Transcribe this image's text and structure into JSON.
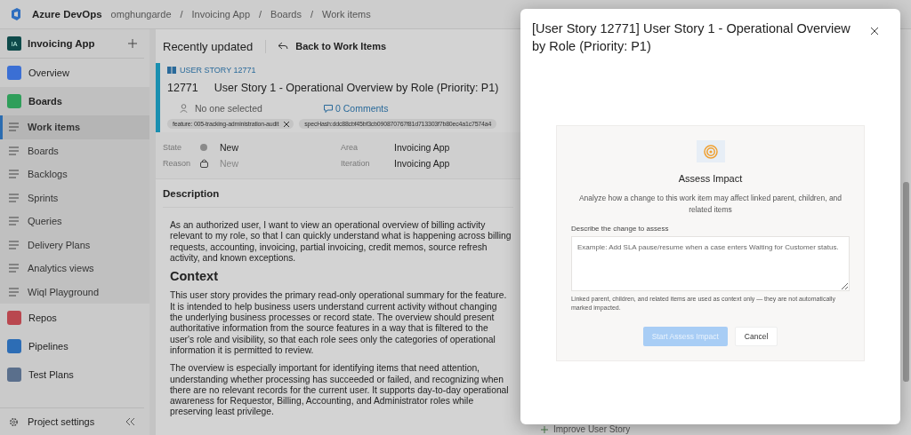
{
  "topbar": {
    "product": "Azure DevOps",
    "separator": "/",
    "breadcrumbs": [
      "omghungarde",
      "Invoicing App",
      "Boards",
      "Work items"
    ]
  },
  "sidebar": {
    "project": {
      "initials": "IA",
      "name": "Invoicing App"
    },
    "items": [
      {
        "label": "Overview",
        "kind": "hub",
        "color": "#3b6fd4",
        "selected": false
      },
      {
        "label": "Boards",
        "kind": "hub",
        "color": "#2f9e5a",
        "selected": true,
        "children": [
          {
            "label": "Work items",
            "selected": true
          },
          {
            "label": "Boards",
            "selected": false
          },
          {
            "label": "Backlogs",
            "selected": false
          },
          {
            "label": "Sprints",
            "selected": false
          },
          {
            "label": "Queries",
            "selected": false
          },
          {
            "label": "Delivery Plans",
            "selected": false
          },
          {
            "label": "Analytics views",
            "selected": false
          },
          {
            "label": "Wiql Playground",
            "selected": false
          }
        ]
      },
      {
        "label": "Repos",
        "kind": "hub",
        "color": "#b9474f",
        "selected": false
      },
      {
        "label": "Pipelines",
        "kind": "hub",
        "color": "#2d6db5",
        "selected": false
      },
      {
        "label": "Test Plans",
        "kind": "hub",
        "color": "#5a6f8c",
        "selected": false
      }
    ],
    "footer": "Project settings"
  },
  "header": {
    "title": "Recently updated",
    "back": "Back to Work Items"
  },
  "work_item": {
    "type": "USER STORY 12771",
    "id": "12771",
    "title": "User Story 1 - Operational Overview by Role (Priority: P1)",
    "assignee": "No one selected",
    "comments": "0 Comments",
    "tags": [
      {
        "label": "feature: 005-tracking-administration-audit",
        "removable": true
      },
      {
        "label": "specHash:ddc88cbf45bf3cb090870767f81d713303f7b80ec4a1c7574a4",
        "removable": false
      }
    ],
    "fields_left": [
      {
        "label": "State",
        "value": "New",
        "kind": "state"
      },
      {
        "label": "Reason",
        "value": "New",
        "kind": "reason"
      }
    ],
    "fields_right": [
      {
        "label": "Area",
        "value": "Invoicing App"
      },
      {
        "label": "Iteration",
        "value": "Invoicing App"
      }
    ]
  },
  "description": {
    "heading": "Description",
    "blocks": [
      {
        "kind": "paragraph",
        "text": "As an authorized user, I want to view an operational overview of billing activity relevant to my role, so that I can quickly understand what is happening across billing requests, accounting, invoicing, partial invoicing, credit memos, source refresh activity, and known exceptions."
      },
      {
        "kind": "heading",
        "text": "Context"
      },
      {
        "kind": "paragraph",
        "text": "This user story provides the primary read-only operational summary for the feature. It is intended to help business users understand current activity without changing the underlying business processes or record state. The overview should present authoritative information from the source features in a way that is filtered to the user's role and visibility, so that each role sees only the categories of operational information it is permitted to review."
      },
      {
        "kind": "paragraph",
        "text": "The overview is especially important for identifying items that need attention, understanding whether processing has succeeded or failed, and recognizing when there are no relevant records for the current user. It supports day-to-day operational awareness for Requestor, Billing, Accounting, and Administrator roles while preserving least privilege."
      }
    ]
  },
  "footer_action": "Improve User Story",
  "dialog": {
    "title": "[User Story 12771] User Story 1 - Operational Overview by Role (Priority: P1)",
    "panel": {
      "heading": "Assess Impact",
      "subtitle": "Analyze how a change to this work item may affect linked parent, children, and related items",
      "field_label": "Describe the change to assess",
      "placeholder": "Example: Add SLA pause/resume when a case enters Waiting for Customer status.",
      "note": "Linked parent, children, and related items are used as context only — they are not automatically marked impacted.",
      "buttons": [
        {
          "label": "Start Assess Impact",
          "kind": "primary",
          "disabled": true
        },
        {
          "label": "Cancel",
          "kind": "secondary",
          "disabled": false
        }
      ]
    }
  }
}
